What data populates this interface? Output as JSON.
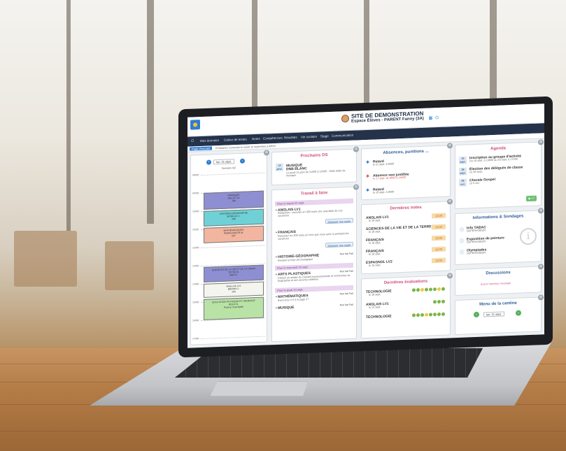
{
  "app": {
    "title": "SITE DE DEMONSTRATION",
    "subtitle": "Espace Élèves - PARENT Fanny (3A)"
  },
  "nav": {
    "items": [
      "Mes données",
      "Cahier de textes",
      "Notes",
      "Compétences",
      "Résultats",
      "Vie scolaire",
      "Stage",
      "Communication"
    ]
  },
  "subnav": {
    "active_tab": "Page d'accueil",
    "info": "Prochaines connexion le mardi 10 septembre à 08h32"
  },
  "timetable": {
    "date": "lun. 21 sept.",
    "week": "Semaine Q2",
    "times": [
      "08h00",
      "09h00",
      "10h00",
      "11h00",
      "12h00",
      "13h00",
      "14h00",
      "15h00",
      "16h00",
      "17h00"
    ],
    "lessons": [
      {
        "label": "FRANÇAIS\nJUILLET M.\n108",
        "color": "#8e8fd2"
      },
      {
        "label": "HISTOIRE-GÉOGRAPHIE\nMOREAU C.\n208",
        "color": "#6fd1d6"
      },
      {
        "label": "MATHÉMATIQUES\nPROFESSEUR M.\n207",
        "color": "#f2b6a0"
      },
      {
        "label": "SCIENCES DE LA VIE ET DE LA TERRE\nTOYER B.\nMAR D.",
        "color": "#8e8fd2"
      },
      {
        "label": "ANGLAIS LV1\nBROWN J.\n109",
        "color": "#f5f5f0"
      },
      {
        "label": "ÉDUCATION PHYSIQUE ET SPORTIVE\nROUX N.\nPiscine municipale",
        "color": "#b9e3a6"
      }
    ]
  },
  "ds": {
    "title": "Prochains DS",
    "day": "14 janv.",
    "subject": "MUSIQUE",
    "type": "DNB BLANC",
    "detail": "Le jeudi 14 janv de 11h00 à 12h00 - Salle Salle de musique"
  },
  "todo": {
    "title": "Travail à faire",
    "groups": [
      {
        "header": "Pour le mardi 22 sept.",
        "items": [
          {
            "subject": "• ANGLAIS LV1",
            "text": "Rédaction : raconter en 300 mots une anecdote de vos vacances",
            "button": "Déposer ma copie"
          },
          {
            "subject": "• FRANÇAIS",
            "text": "Résumez en 400 mots un livre que vous avez lu pendant les vacances",
            "button": "Déposer ma copie"
          },
          {
            "subject": "• HISTOIRE-GÉOGRAPHIE",
            "text": "Remplir la frise chronologique",
            "toggle": "Non fait  Fait"
          }
        ]
      },
      {
        "header": "Pour le mercredi 23 sept.",
        "items": [
          {
            "subject": "• ARTS PLASTIQUES",
            "text": "Choisir un artiste du courant impressionniste et rechercher sa biographie et ses œuvres célèbres",
            "toggle": "Non fait  Fait"
          }
        ]
      },
      {
        "header": "Pour le jeudi 24 sept.",
        "items": [
          {
            "subject": "• MATHÉMATIQUES",
            "text": "Exercices n°2 à 8 page 27",
            "toggle": "Non fait  Fait"
          },
          {
            "subject": "• MUSIQUE",
            "text": "",
            "toggle": "Non fait  Fait"
          }
        ]
      }
    ]
  },
  "absences": {
    "title": "Absences, punitions ...",
    "items": [
      {
        "label": "Retard",
        "date": "le 21 sept. à 8h00",
        "icon": "runner-icon",
        "alert": false
      },
      {
        "label": "Absence non justifiée",
        "date": "le 17 sept. de 8h00 à 18h00",
        "icon": "runner-icon",
        "alert": true
      },
      {
        "label": "Retard",
        "date": "le 10 sept. à 8h00",
        "icon": "runner-icon",
        "alert": false
      }
    ]
  },
  "grades": {
    "title": "Dernières notes",
    "items": [
      {
        "subject": "ANGLAIS LV1",
        "date": "le 19 sept.",
        "grade": "12,00"
      },
      {
        "subject": "SCIENCES DE LA VIE ET DE LA TERRE",
        "date": "le 18 sept.",
        "grade": "14,50"
      },
      {
        "subject": "FRANÇAIS",
        "date": "le 18 sept.",
        "grade": "15,00"
      },
      {
        "subject": "FRANÇAIS",
        "date": "le 18 sept.",
        "grade": "14,00"
      },
      {
        "subject": "ESPAGNOL LV2",
        "date": "le 15 sept.",
        "grade": "13,00"
      }
    ]
  },
  "evaluations": {
    "title": "Dernières évaluations",
    "items": [
      {
        "subject": "TECHNOLOGIE",
        "date": "le 18 sept.",
        "dots": [
          "#7ab648",
          "#7ab648",
          "#f4c542",
          "#7ab648",
          "#7ab648",
          "#7ab648",
          "#f4c542",
          "#7ab648"
        ]
      },
      {
        "subject": "ANGLAIS LV1",
        "date": "le 12 sept.",
        "dots": [
          "#7ab648",
          "#7ab648",
          "#7ab648"
        ]
      },
      {
        "subject": "TECHNOLOGIE",
        "date": "",
        "dots": [
          "#7ab648",
          "#7ab648",
          "#7ab648",
          "#f4c542",
          "#7ab648",
          "#7ab648",
          "#7ab648",
          "#7ab648"
        ]
      }
    ]
  },
  "agenda": {
    "title": "Agenda",
    "items": [
      {
        "day": "16",
        "month": "sept.",
        "title": "Inscription au groupe d'activité",
        "detail": "Du 16 sept. à 14h00 au 25 sept. à 17h00"
      },
      {
        "day": "28",
        "month": "sept.",
        "title": "Élection des délégués de classe",
        "detail": "Le 28 sept."
      },
      {
        "day": "06",
        "month": "oct.",
        "title": "Chorale Gospel",
        "detail": "Le 6 oct."
      }
    ],
    "more": "+7"
  },
  "info": {
    "title": "Informations & Sondages",
    "items": [
      {
        "title": "Info TABAC",
        "author": "SUPERVISEUR"
      },
      {
        "title": "Exposition de peinture",
        "author": "SUPERVISEUR"
      },
      {
        "title": "Olympiades",
        "author": "SUPERVISEUR"
      }
    ]
  },
  "discussions": {
    "title": "Discussions",
    "empty": "Aucun nouveau message"
  },
  "canteen": {
    "title": "Menu de la cantine",
    "date": "lun. 21 sept."
  },
  "colors": {
    "brand": "#2f7dd1",
    "nav": "#24324a",
    "title_pink": "#d04f7a"
  }
}
